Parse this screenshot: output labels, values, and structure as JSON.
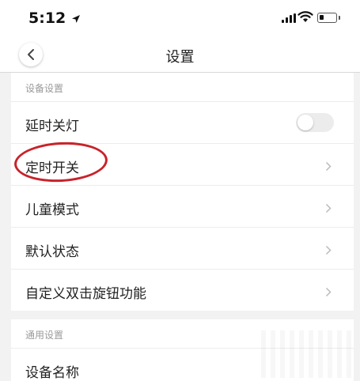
{
  "status_bar": {
    "time": "5:12"
  },
  "nav": {
    "title": "设置"
  },
  "sections": [
    {
      "header": "设备设置",
      "rows": [
        {
          "label": "延时关灯",
          "control": "toggle",
          "toggle_on": false
        },
        {
          "label": "定时开关",
          "control": "chevron"
        },
        {
          "label": "儿童模式",
          "control": "chevron"
        },
        {
          "label": "默认状态",
          "control": "chevron"
        },
        {
          "label": "自定义双击旋钮功能",
          "control": "chevron"
        }
      ]
    },
    {
      "header": "通用设置",
      "rows": [
        {
          "label": "设备名称",
          "control": "none"
        }
      ]
    }
  ],
  "colors": {
    "background": "#f2f2f2",
    "highlight": "#c8232a",
    "secondary_text": "#9a9a9a"
  }
}
